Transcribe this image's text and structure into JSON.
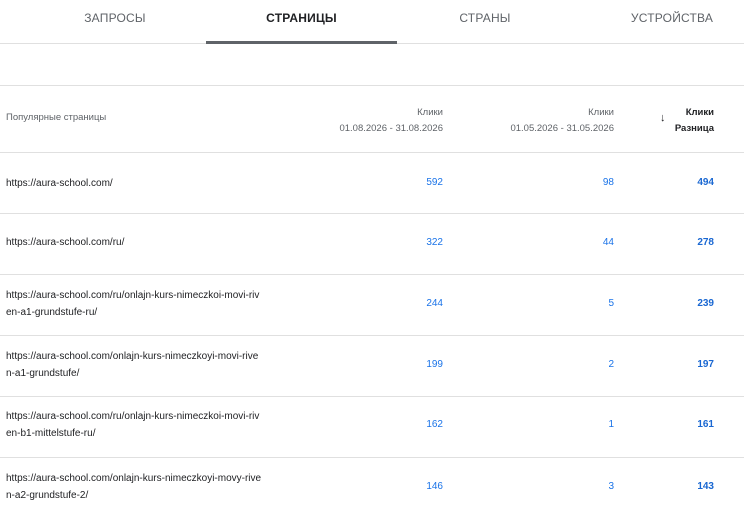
{
  "tabs": [
    {
      "label": "ЗАПРОСЫ"
    },
    {
      "label": "СТРАНИЦЫ"
    },
    {
      "label": "СТРАНЫ"
    },
    {
      "label": "УСТРОЙСТВА"
    }
  ],
  "table": {
    "headers": {
      "page": "Популярные страницы",
      "clicks_current_label": "Клики",
      "clicks_current_range": "01.08.2026 - 31.08.2026",
      "clicks_previous_label": "Клики",
      "clicks_previous_range": "01.05.2026 - 31.05.2026",
      "diff_label": "Клики",
      "diff_sub": "Разница",
      "sort_icon": "↓"
    },
    "rows": [
      {
        "url": "https://aura-school.com/",
        "current": "592",
        "previous": "98",
        "diff": "494"
      },
      {
        "url": "https://aura-school.com/ru/",
        "current": "322",
        "previous": "44",
        "diff": "278"
      },
      {
        "url": "https://aura-school.com/ru/onlajn-kurs-nimeczkoi-movi-riv\nen-a1-grundstufe-ru/",
        "current": "244",
        "previous": "5",
        "diff": "239"
      },
      {
        "url": "https://aura-school.com/onlajn-kurs-nimeczkoyi-movi-rive\nn-a1-grundstufe/",
        "current": "199",
        "previous": "2",
        "diff": "197"
      },
      {
        "url": "https://aura-school.com/ru/onlajn-kurs-nimeczkoi-movi-riv\nen-b1-mittelstufe-ru/",
        "current": "162",
        "previous": "1",
        "diff": "161"
      },
      {
        "url": "https://aura-school.com/onlajn-kurs-nimeczkoyi-movy-rive\nn-a2-grundstufe-2/",
        "current": "146",
        "previous": "3",
        "diff": "143"
      }
    ]
  }
}
